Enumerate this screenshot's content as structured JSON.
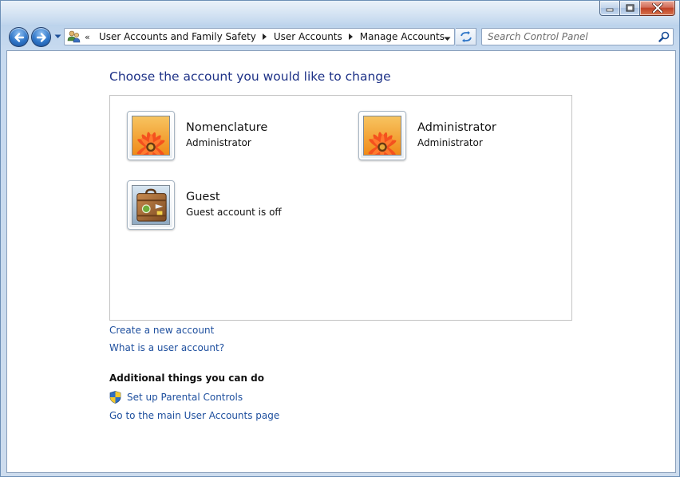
{
  "breadcrumbs": [
    {
      "label": "User Accounts and Family Safety"
    },
    {
      "label": "User Accounts"
    },
    {
      "label": "Manage Accounts"
    }
  ],
  "breadcrumb_overflow": "«",
  "search": {
    "placeholder": "Search Control Panel"
  },
  "page_title": "Choose the account you would like to change",
  "accounts": [
    {
      "name": "Nomenclature",
      "type": "Administrator",
      "picture": "flower-picture"
    },
    {
      "name": "Administrator",
      "type": "Administrator",
      "picture": "flower-picture"
    },
    {
      "name": "Guest",
      "type": "Guest account is off",
      "picture": "suitcase-picture"
    }
  ],
  "links": {
    "create_account": "Create a new account",
    "what_is_account": "What is a user account?"
  },
  "additional": {
    "heading": "Additional things you can do",
    "parental_controls": "Set up Parental Controls",
    "main_page": "Go to the main User Accounts page"
  },
  "colors": {
    "title_blue": "#1e3287",
    "link_blue": "#1e4f9e",
    "close_red": "#c04126"
  }
}
